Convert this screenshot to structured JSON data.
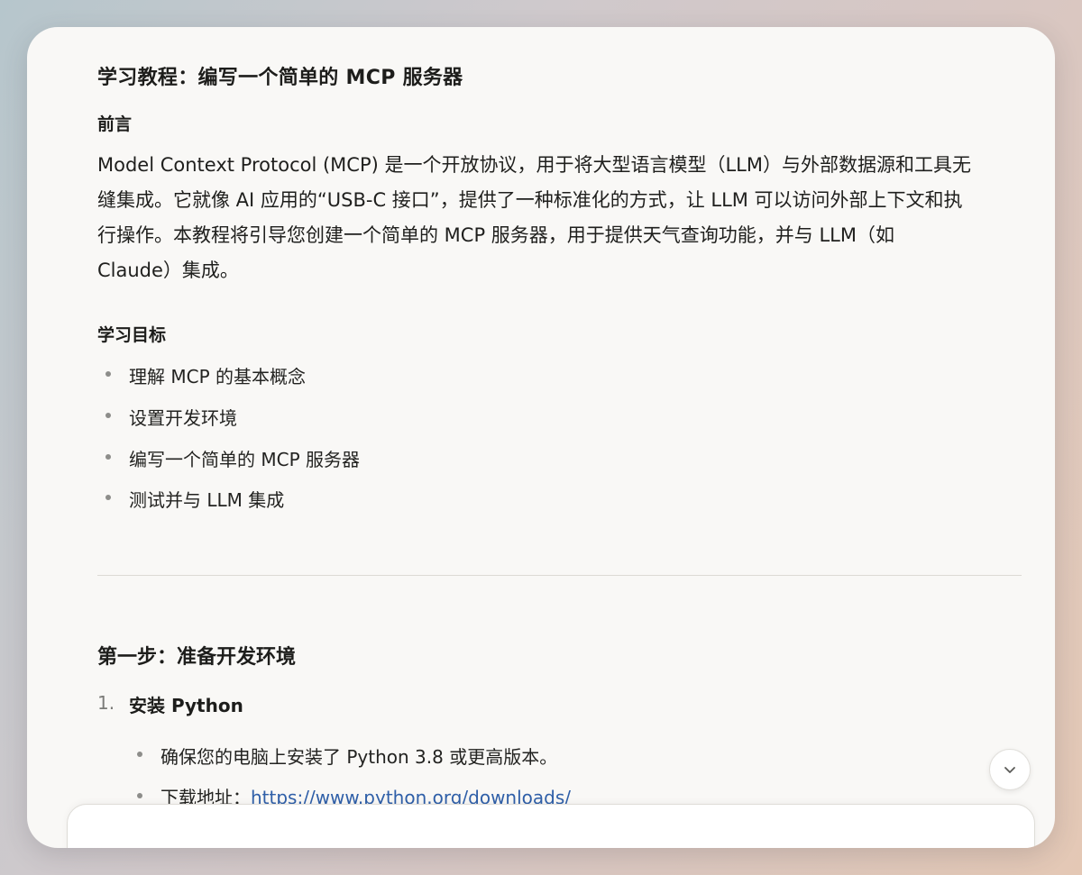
{
  "article": {
    "title": "学习教程：编写一个简单的 MCP 服务器",
    "intro_heading": "前言",
    "intro_lines": [
      "Model Context Protocol (MCP) 是一个开放协议，用于将大型语言模型（LLM）与外部数据源和工具无",
      "缝集成。它就像 AI 应用的“USB-C 接口”，提供了一种标准化的方式，让 LLM 可以访问外部上下文和执",
      "行操作。本教程将引导您创建一个简单的 MCP 服务器，用于提供天气查询功能，并与 LLM（如",
      "Claude）集成。"
    ],
    "goals_heading": "学习目标",
    "goals": [
      "理解 MCP 的基本概念",
      "设置开发环境",
      "编写一个简单的 MCP 服务器",
      "测试并与 LLM 集成"
    ],
    "step1_heading": "第一步：准备开发环境",
    "step1_items": [
      {
        "number": "1.",
        "label": "安装 Python",
        "bullets": [
          {
            "text": "确保您的电脑上安装了 Python 3.8 或更高版本。",
            "link": ""
          },
          {
            "text": "下载地址：",
            "link": "https://www.python.org/downloads/"
          }
        ]
      }
    ]
  },
  "composer": {
    "placeholder": ""
  },
  "icons": {
    "scroll_down": "chevron-down-icon"
  },
  "colors": {
    "link": "#2f5fa8",
    "card_bg": "#f9f8f6"
  }
}
